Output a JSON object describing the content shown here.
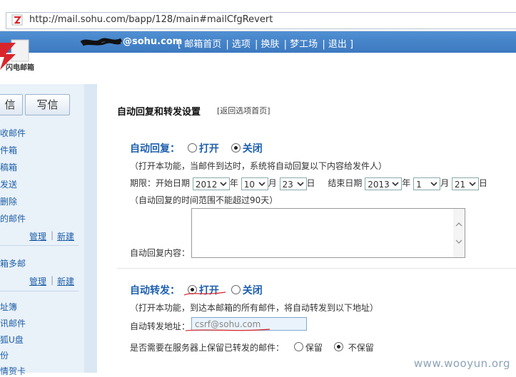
{
  "browser": {
    "url": "http://mail.sohu.com/bapp/128/main#mailCfgRevert"
  },
  "topbar": {
    "user": "@sohu.com",
    "links": [
      "[ 邮箱首页",
      "| 选项",
      "| 换肤",
      "| 梦工场",
      "| 退出 ]"
    ]
  },
  "logo": {
    "name": "闪电邮箱"
  },
  "sidebar": {
    "btn_receive": "信",
    "btn_compose": "写信",
    "folders": [
      "收邮件",
      "件箱",
      "稿箱",
      "发送",
      "删除",
      "的邮件"
    ],
    "manage": "管理",
    "new": "新建",
    "multi": "箱多邮",
    "manage2": "管理",
    "new2": "新建",
    "tools": [
      "址簿",
      "讯邮件",
      "狐U盘",
      "份",
      "情贺卡"
    ]
  },
  "main": {
    "title": "自动回复和转发设置",
    "back": "[返回选项首页]",
    "auto_reply": {
      "label": "自动回复：",
      "on": "打开",
      "off": "关闭",
      "selected": "off",
      "note": "（打开本功能，当邮件到达时，系统将自动回复以下内容给发件人）",
      "period_label": "期限：开始日期",
      "start_year": "2012",
      "start_month": "10",
      "start_day": "23",
      "year_unit": "年",
      "month_unit": "月",
      "day_unit": "日",
      "end_label": "结束日期",
      "end_year": "2013",
      "end_month": "1",
      "end_day": "21",
      "range_note": "（自动回复的时间范围不能超过90天）",
      "content_label": "自动回复内容："
    },
    "auto_forward": {
      "label": "自动转发：",
      "on": "打开",
      "off": "关闭",
      "selected": "on",
      "note": "（打开本功能，到达本邮箱的所有邮件，将自动转发到以下地址）",
      "address_label": "自动转发地址：",
      "address_value": "csrf@sohu.com",
      "keep_question": "是否需要在服务器上保留已转发的邮件：",
      "keep": "保留",
      "no_keep": "不保留",
      "keep_selected": "no_keep"
    }
  },
  "watermark": "www.wooyun.org",
  "colors": {
    "accent": "#1d5fae",
    "topbar": "#4a89cf",
    "sidebar": "#e9f1f9"
  }
}
